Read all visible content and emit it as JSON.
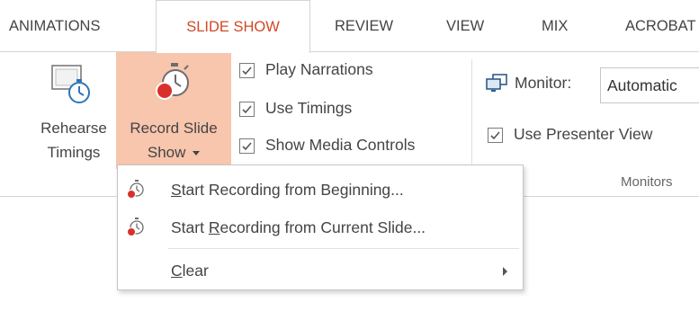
{
  "tabs": [
    {
      "label": "ANIMATIONS",
      "active": false
    },
    {
      "label": "SLIDE SHOW",
      "active": true
    },
    {
      "label": "REVIEW",
      "active": false
    },
    {
      "label": "VIEW",
      "active": false
    },
    {
      "label": "MIX",
      "active": false
    },
    {
      "label": "ACROBAT",
      "active": false
    }
  ],
  "ribbon": {
    "rehearse_timings": {
      "line1": "Rehearse",
      "line2": "Timings",
      "icon": "stopwatch-slide-icon"
    },
    "record_slide_show": {
      "line1": "Record Slide",
      "line2": "Show",
      "icon": "record-stopwatch-icon",
      "pressed": true
    },
    "checkboxes": [
      {
        "label": "Play Narrations",
        "checked": true
      },
      {
        "label": "Use Timings",
        "checked": true
      },
      {
        "label": "Show Media Controls",
        "checked": true
      }
    ],
    "monitor": {
      "label": "Monitor:",
      "value": "Automatic",
      "icon": "monitor-icon"
    },
    "use_presenter_view": {
      "label": "Use Presenter View",
      "checked": true
    },
    "monitors_group_label": "Monitors"
  },
  "menu": {
    "items": [
      {
        "pre": "",
        "underline": "S",
        "post": "tart Recording from Beginning...",
        "icon": "record-stopwatch-icon"
      },
      {
        "pre": "Start ",
        "underline": "R",
        "post": "ecording from Current Slide...",
        "icon": "record-stopwatch-icon"
      },
      {
        "pre": "",
        "underline": "C",
        "post": "lear",
        "icon": "",
        "submenu": true
      }
    ]
  },
  "colors": {
    "accent": "#d24726",
    "pressed": "#f8c5ad",
    "text": "#444444",
    "border": "#d5d5d5"
  }
}
